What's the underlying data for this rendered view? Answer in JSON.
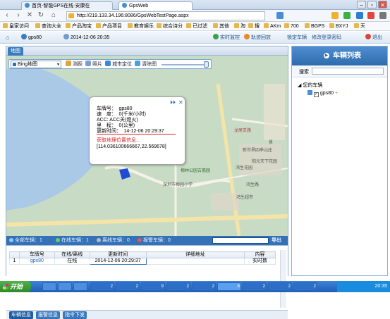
{
  "browser": {
    "tabs": [
      {
        "label": "首页-智能GPS在线·安康在",
        "active": false
      },
      {
        "label": "GpsWeb",
        "active": true
      }
    ],
    "url": "http://219.133.34.196:8086/GpsWebTestPage.aspx",
    "window_controls": [
      "–",
      "▫",
      "✕"
    ],
    "bookmarks": [
      "皇家访问",
      "查询大全",
      "产品淘宝",
      "产品项目",
      "教育娱乐",
      "综合诗分",
      "已过滤",
      "其他",
      "淘",
      "搜",
      "AKm",
      "700",
      "BGPS",
      "BXYJ",
      "天"
    ]
  },
  "app": {
    "user": "gps80",
    "datetime": "2014-12-06 20:35",
    "header_links": [
      "实时监控",
      "轨迹回放",
      "锁定车辆",
      "修改登录密码",
      "退出"
    ]
  },
  "map_panel": {
    "tab": "地图",
    "map_type": "Bing地图",
    "tools": [
      "测距",
      "照片",
      "城市定位",
      "清除图"
    ],
    "popup": {
      "plate": "车牌号：　gps80",
      "speed": "速　度：　0(千米/小时)",
      "acc": "ACC: ACC关(熄火)",
      "mileage": "里　程：　0(公里)",
      "updated": "更新时间：　14-12-06 20:29:37",
      "location_link": "获取地理位置信息...",
      "coords": "[114.036100666667,22.569678]"
    },
    "map_labels": [
      "龙尾支路",
      "新世界四季山庄",
      "梅林公园古荔园",
      "鸿生花园",
      "阳光天下花园",
      "深圳市梅园小学",
      "鸿生路",
      "鸿生超市",
      "景"
    ],
    "status": {
      "all": "全部车辆：1",
      "online": "在线车辆：1",
      "offline": "离线车辆：0",
      "alarm": "报警车辆：0",
      "export": "导出"
    }
  },
  "vehicle_table": {
    "columns": [
      "",
      "车牌号",
      "在线/离线",
      "更新时间",
      "详细地址",
      "内容"
    ],
    "rows": [
      {
        "index": "1",
        "plate": "gps80",
        "status": "在线",
        "time": "2014-12-06 20:29:37",
        "address": "",
        "content": "实时数"
      }
    ]
  },
  "bottom_tabs": [
    "车辆信息",
    "报警信息",
    "指令下发"
  ],
  "vehicle_list": {
    "title": "车辆列表",
    "search_label": "搜索",
    "group": "您的车辆",
    "vehicle": "gps80"
  },
  "taskbar": {
    "start": "开始",
    "apps": [
      "2",
      "2",
      "9",
      "2",
      "2",
      "6",
      "2",
      "2",
      "2"
    ],
    "time": "20:35"
  },
  "colors": {
    "accent": "#3571b6",
    "header_link": "#1a4f8a",
    "alert_red": "#d22"
  }
}
